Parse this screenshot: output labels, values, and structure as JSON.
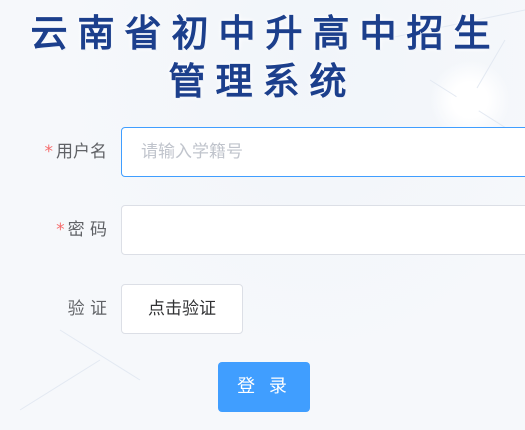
{
  "header": {
    "title_line1": "云南省初中升高中招生",
    "title_line2": "管理系统"
  },
  "form": {
    "required_mark": "*",
    "username": {
      "label": "用户名",
      "placeholder": "请输入学籍号",
      "value": ""
    },
    "password": {
      "label": "密 码",
      "value": ""
    },
    "captcha": {
      "label": "验 证",
      "button_label": "点击验证"
    },
    "submit_label": "登 录"
  },
  "colors": {
    "title": "#1c3f8c",
    "required": "#f56c6c",
    "primary": "#409eff",
    "focus_border": "#409eff"
  }
}
